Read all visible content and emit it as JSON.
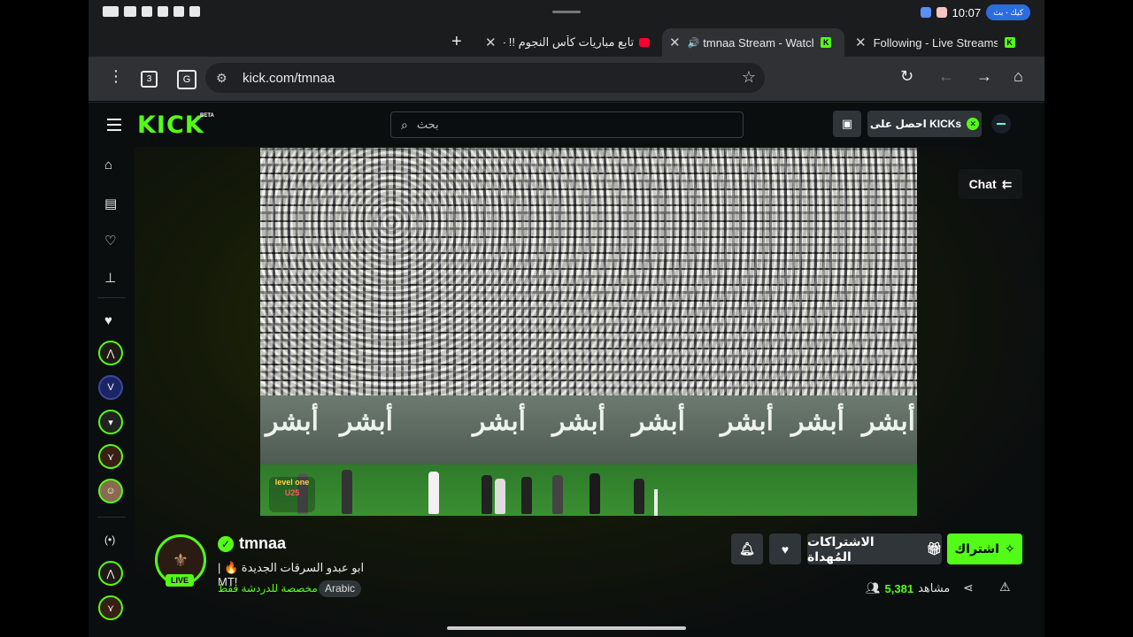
{
  "status_bar": {
    "time": "10:07",
    "pill_text": "كيك - بث"
  },
  "tabs": [
    {
      "title": "Following - Live Streams on",
      "active": false
    },
    {
      "title": "tmnaa Stream - Watch L",
      "active": true
    },
    {
      "title": "تابع مباريات كأس النجوم !! - ube",
      "active": false
    }
  ],
  "browser": {
    "tab_count": "3",
    "url": "kick.com/tmnaa"
  },
  "kick_header": {
    "logo": "KICK",
    "beta": "BETA",
    "search_placeholder": "بحث",
    "get_kicks_label": "احصل على KICKs"
  },
  "chat_button_label": "Chat",
  "channel": {
    "name": "tmnaa",
    "live_badge": "LIVE",
    "title": "ابو عبدو السرقات الجديدة 🔥 | !MT",
    "category": "مخصصة للدردشة فقط",
    "language_tag": "Arabic",
    "viewers_label": "مشاهد",
    "viewers_count": "5,381"
  },
  "actions": {
    "gift_subs_label": "الاشتراكات المُهداة",
    "subscribe_label": "اشتراك"
  },
  "video": {
    "board_text": "أبشر",
    "corner_logo": "level one",
    "corner_logo_2": "U25"
  },
  "colors": {
    "kick_green": "#53fc18",
    "button_gray": "#2f3538",
    "background": "#0b0e0f"
  }
}
